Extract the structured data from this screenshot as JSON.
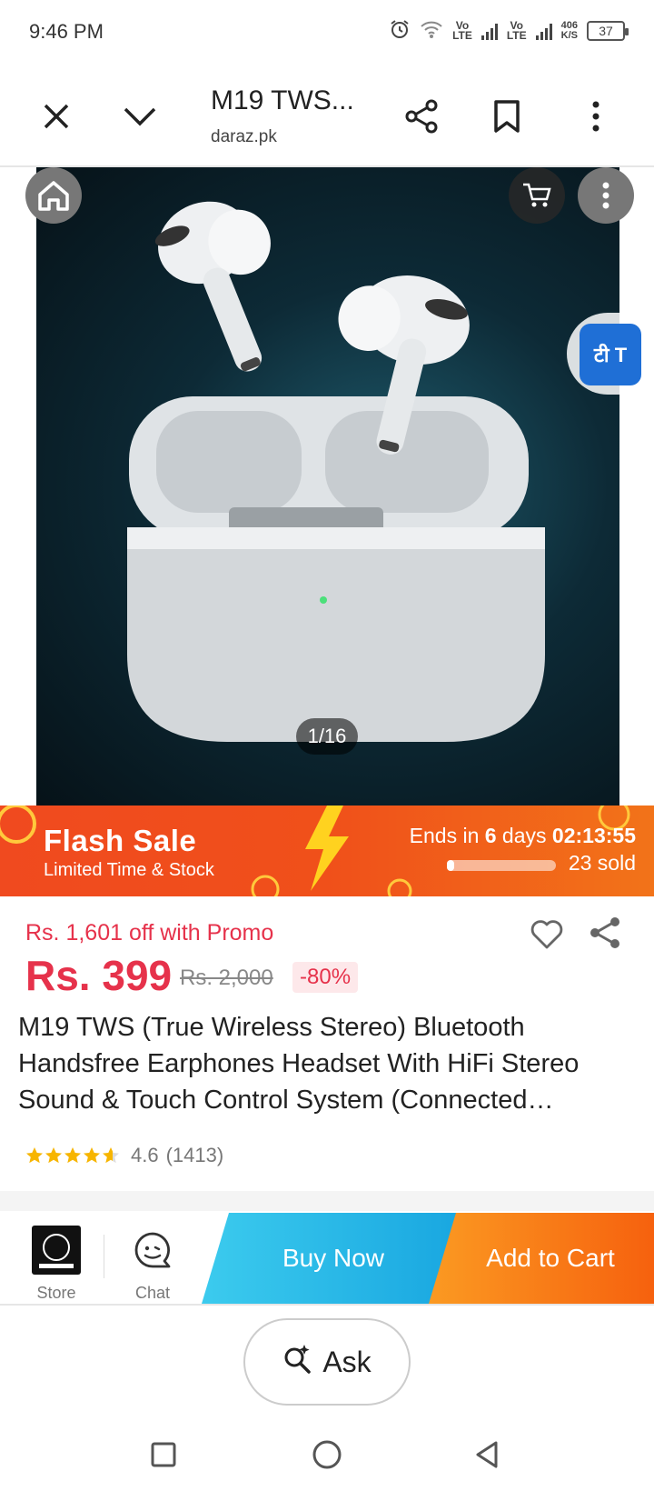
{
  "status": {
    "time": "9:46 PM",
    "net1": "Vo\nLTE",
    "net2": "Vo\nLTE",
    "speed": "406\nK/S",
    "battery": "37"
  },
  "browser": {
    "title": "M19 TWS...",
    "domain": "daraz.pk"
  },
  "gallery": {
    "counter": "1/16",
    "translate_label": "टी T"
  },
  "flash_sale": {
    "title": "Flash Sale",
    "subtitle": "Limited Time & Stock",
    "ends_prefix": "Ends in ",
    "days": "6",
    "days_label": " days ",
    "countdown": "02:13:55",
    "sold": "23 sold",
    "progress": 0.06
  },
  "price": {
    "promo": "Rs. 1,601 off with Promo",
    "current": "Rs. 399",
    "original": "Rs. 2,000",
    "discount": "-80%"
  },
  "product": {
    "title": "M19 TWS (True Wireless Stereo) Bluetooth Handsfree Earphones Headset With HiFi Stereo Sound & Touch Control System (Connected…",
    "rating": "4.6",
    "reviews": "(1413)",
    "stars": 4.6
  },
  "action_bar": {
    "store_label": "Store",
    "chat_label": "Chat",
    "buy_now": "Buy Now",
    "add_to_cart": "Add to Cart"
  },
  "ask": {
    "label": "Ask"
  },
  "colors": {
    "accent": "#e6324b",
    "flash": "#f04a1f",
    "buy_now": "#18a6e0",
    "add_to_cart": "#f6610e"
  }
}
